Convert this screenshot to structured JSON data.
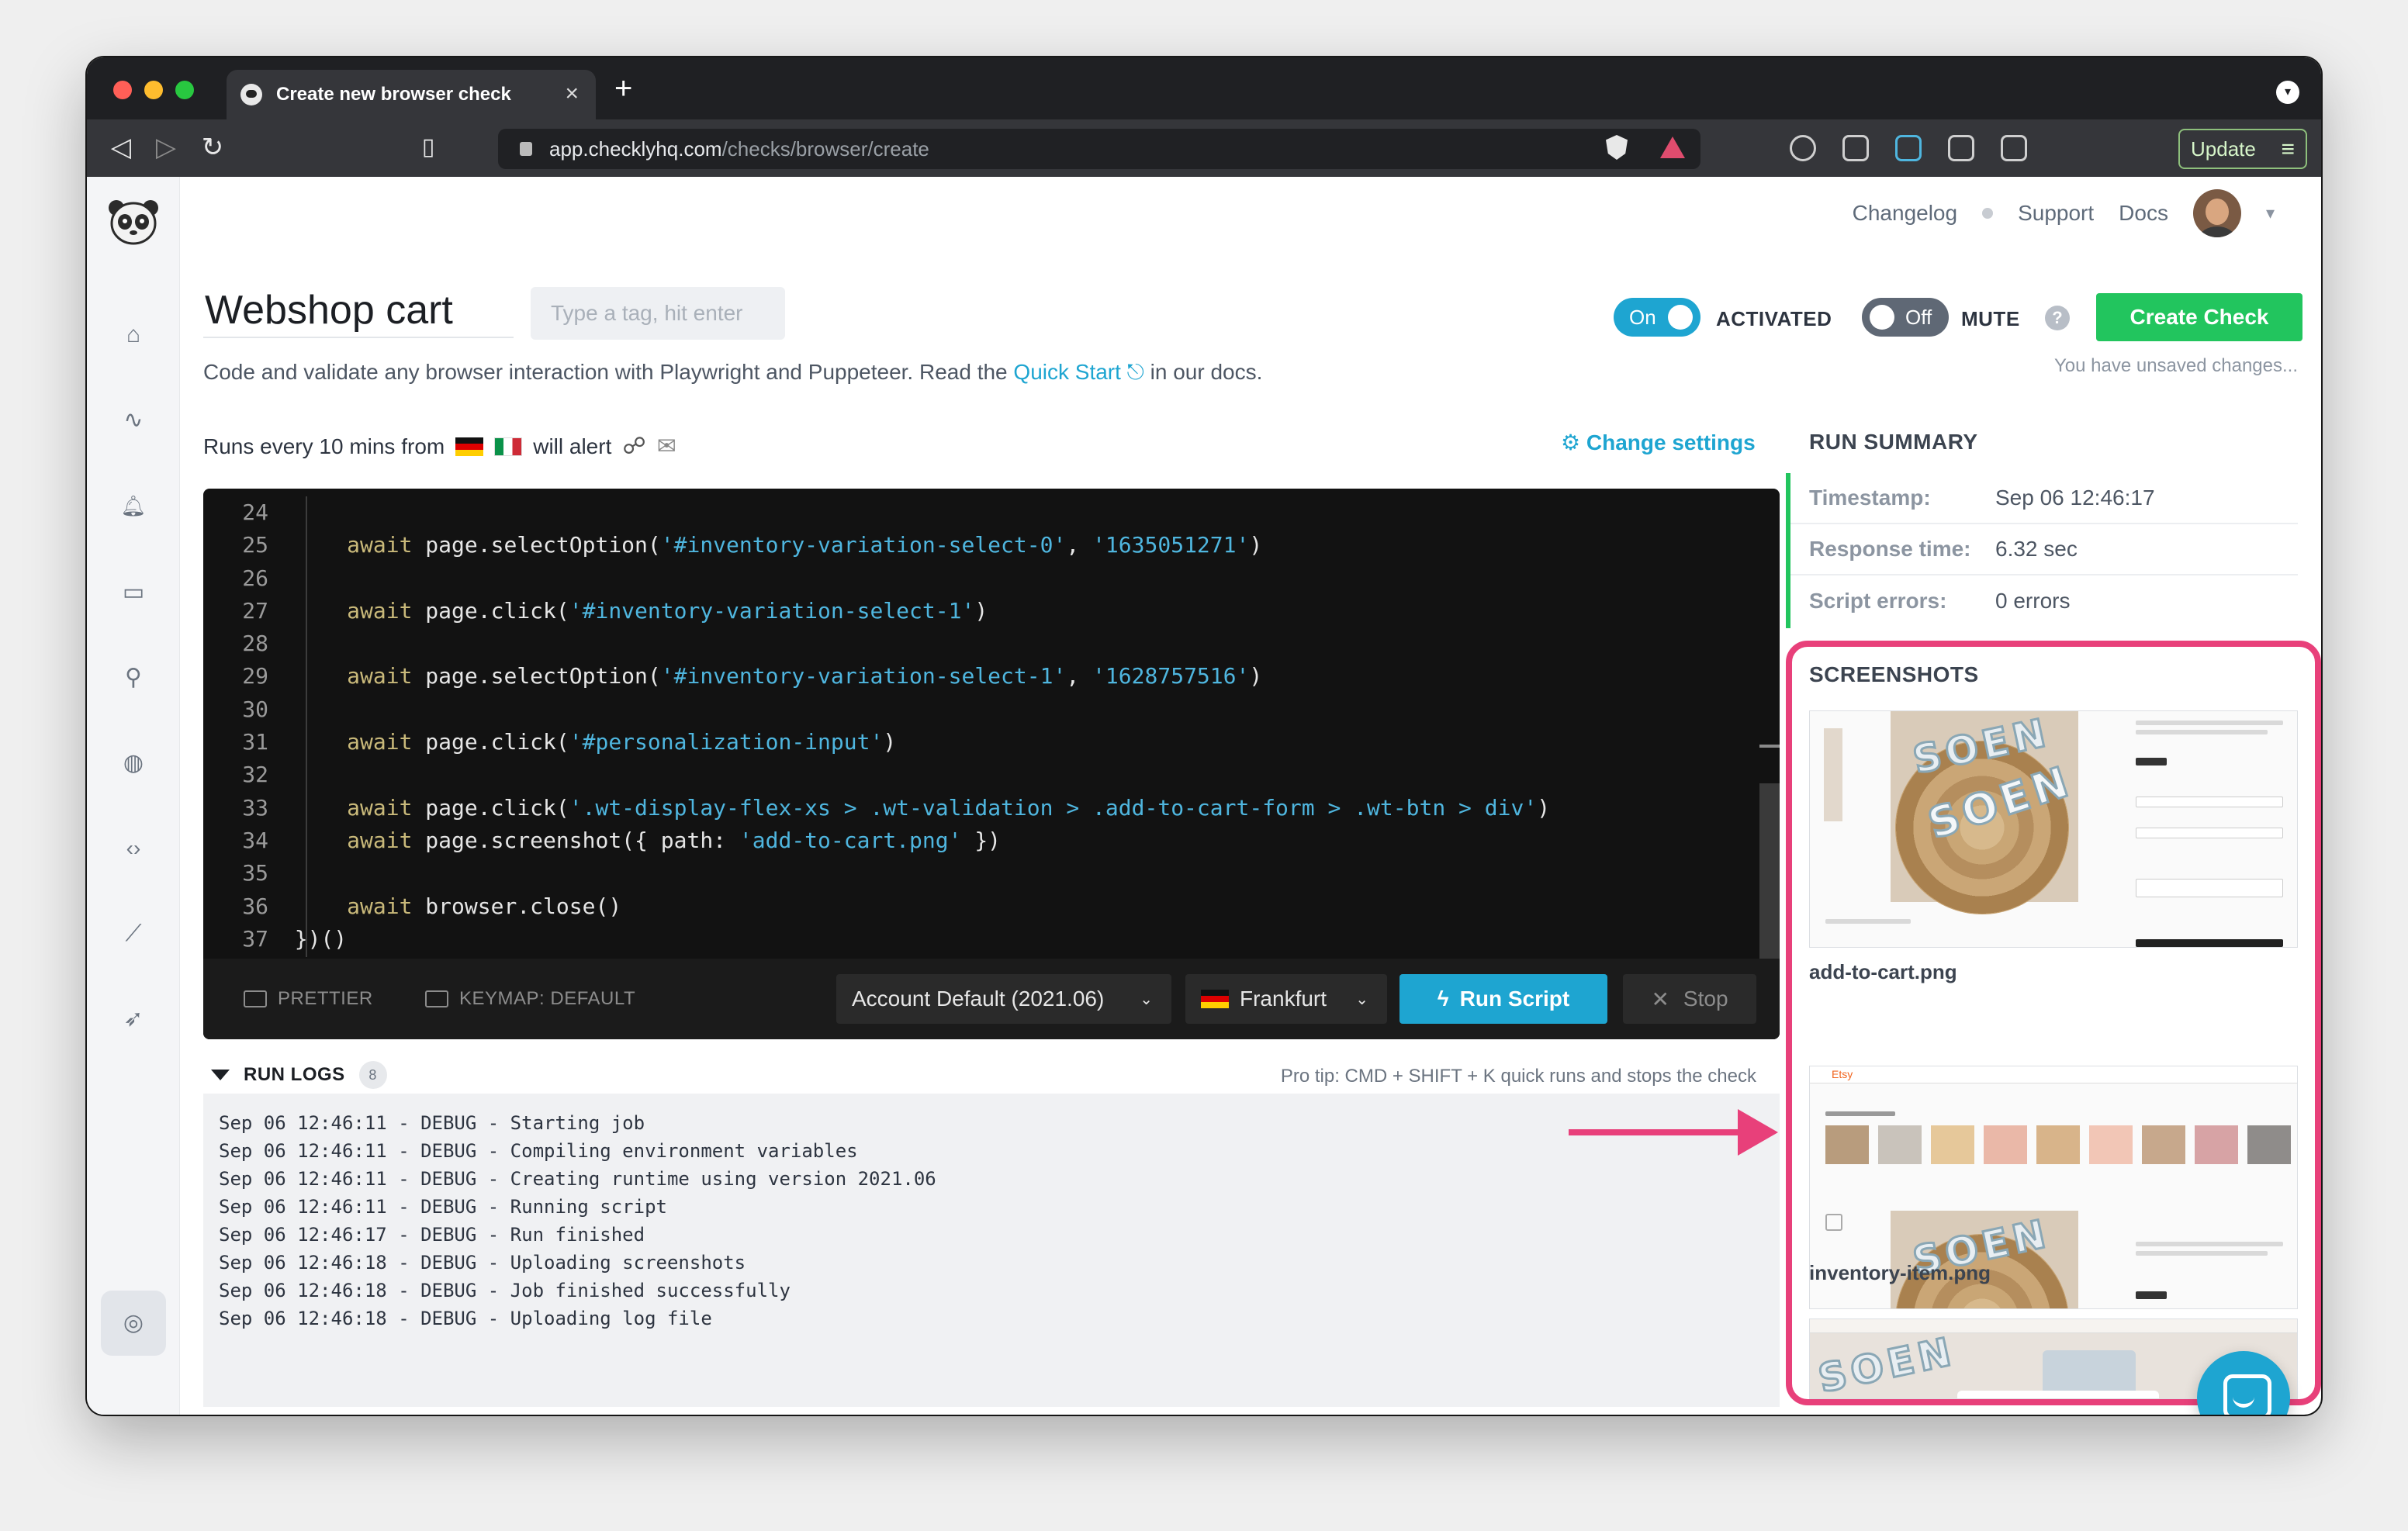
{
  "browser": {
    "tab_title": "Create new browser check",
    "url_domain": "app.checklyhq.com",
    "url_path": "/checks/browser/create",
    "update_label": "Update"
  },
  "topnav": {
    "changelog": "Changelog",
    "support": "Support",
    "docs": "Docs"
  },
  "check": {
    "name": "Webshop cart",
    "tag_placeholder": "Type a tag, hit enter",
    "desc_prefix": "Code and validate any browser interaction with Playwright and Puppeteer. Read the",
    "quick_start": "Quick Start",
    "desc_suffix": "in our docs.",
    "activated_toggle": "On",
    "activated_label": "ACTIVATED",
    "mute_toggle": "Off",
    "mute_label": "MUTE",
    "help": "?",
    "create_label": "Create Check",
    "unsaved": "You have unsaved changes...",
    "runs_prefix": "Runs every 10 mins from",
    "will_alert": "will alert",
    "change_settings": "Change settings"
  },
  "editor": {
    "lines": [
      {
        "n": "24",
        "code": ""
      },
      {
        "n": "25",
        "code": "    await page.selectOption('#inventory-variation-select-0', '1635051271')"
      },
      {
        "n": "26",
        "code": ""
      },
      {
        "n": "27",
        "code": "    await page.click('#inventory-variation-select-1')"
      },
      {
        "n": "28",
        "code": ""
      },
      {
        "n": "29",
        "code": "    await page.selectOption('#inventory-variation-select-1', '1628757516')"
      },
      {
        "n": "30",
        "code": ""
      },
      {
        "n": "31",
        "code": "    await page.click('#personalization-input')"
      },
      {
        "n": "32",
        "code": ""
      },
      {
        "n": "33",
        "code": "    await page.click('.wt-display-flex-xs > .wt-validation > .add-to-cart-form > .wt-btn > div')"
      },
      {
        "n": "34",
        "code": "    await page.screenshot({ path: 'add-to-cart.png' })"
      },
      {
        "n": "35",
        "code": ""
      },
      {
        "n": "36",
        "code": "    await browser.close()"
      },
      {
        "n": "37",
        "code": "})()"
      }
    ],
    "prettier": "PRETTIER",
    "keymap": "KEYMAP: DEFAULT",
    "runtime": "Account Default (2021.06)",
    "location": "Frankfurt",
    "run_label": "Run Script",
    "stop_label": "Stop"
  },
  "logs": {
    "title": "RUN LOGS",
    "count": "8",
    "protip": "Pro tip: CMD + SHIFT + K quick runs and stops the check",
    "lines": [
      "Sep 06 12:46:11 - DEBUG - Starting job",
      "Sep 06 12:46:11 - DEBUG - Compiling environment variables",
      "Sep 06 12:46:11 - DEBUG - Creating runtime using version 2021.06",
      "Sep 06 12:46:11 - DEBUG - Running script",
      "Sep 06 12:46:17 - DEBUG - Run finished",
      "Sep 06 12:46:18 - DEBUG - Uploading screenshots",
      "Sep 06 12:46:18 - DEBUG - Job finished successfully",
      "Sep 06 12:46:18 - DEBUG - Uploading log file"
    ]
  },
  "summary": {
    "title": "RUN SUMMARY",
    "rows": [
      {
        "label": "Timestamp:",
        "value": "Sep 06 12:46:17"
      },
      {
        "label": "Response time:",
        "value": "6.32 sec"
      },
      {
        "label": "Script errors:",
        "value": "0 errors"
      }
    ]
  },
  "screenshots": {
    "title": "SCREENSHOTS",
    "items": [
      "add-to-cart.png",
      "inventory-item.png"
    ]
  },
  "colors": {
    "accent": "#1ea5d1",
    "success": "#22c55e",
    "highlight": "#e8407a"
  }
}
